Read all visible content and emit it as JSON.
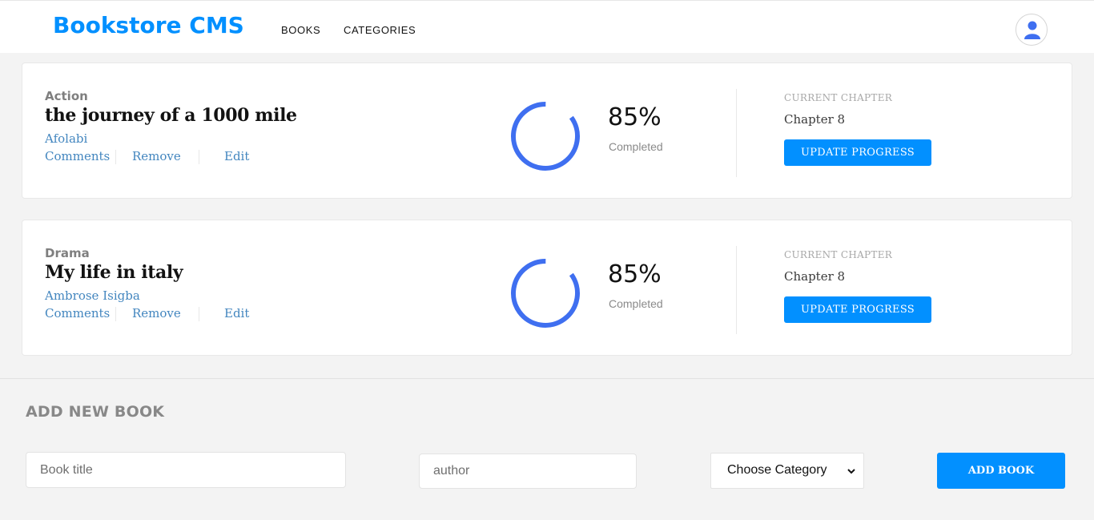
{
  "header": {
    "logo": "Bookstore CMS",
    "nav": [
      "BOOKS",
      "CATEGORIES"
    ]
  },
  "books": [
    {
      "category": "Action",
      "title": "the journey of a 1000 mile",
      "author": "Afolabi",
      "actions": [
        "Comments",
        "Remove",
        "Edit"
      ],
      "progress_percent": 85,
      "percent_label": "85%",
      "completed_label": "Completed",
      "current_chapter_label": "CURRENT CHAPTER",
      "current_chapter": "Chapter 8",
      "update_button": "UPDATE PROGRESS"
    },
    {
      "category": "Drama",
      "title": "My life in italy",
      "author": "Ambrose Isigba",
      "actions": [
        "Comments",
        "Remove",
        "Edit"
      ],
      "progress_percent": 85,
      "percent_label": "85%",
      "completed_label": "Completed",
      "current_chapter_label": "CURRENT CHAPTER",
      "current_chapter": "Chapter 8",
      "update_button": "UPDATE PROGRESS"
    }
  ],
  "form": {
    "title": "ADD NEW BOOK",
    "title_placeholder": "Book title",
    "author_placeholder": "author",
    "category_selected": "Choose Category",
    "submit": "ADD BOOK"
  },
  "colors": {
    "accent": "#0290ff",
    "ring": "#3f6ff0",
    "link": "#4386bf"
  },
  "icons": {
    "avatar": "user-icon",
    "select": "chevron-down-icon"
  }
}
